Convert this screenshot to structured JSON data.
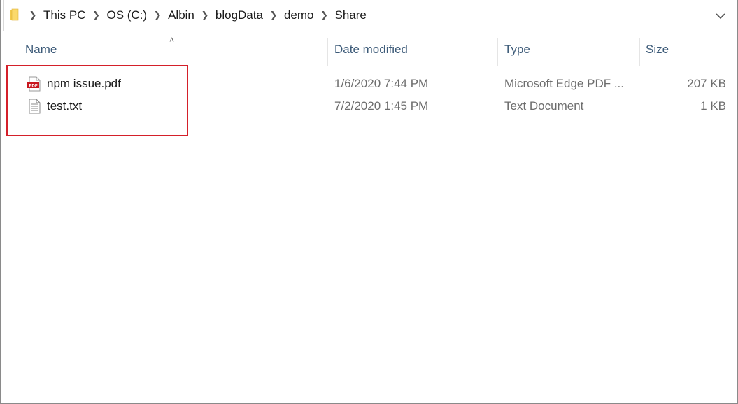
{
  "address_bar": {
    "breadcrumbs": [
      "This PC",
      "OS (C:)",
      "Albin",
      "blogData",
      "demo",
      "Share"
    ]
  },
  "columns": {
    "name": "Name",
    "date_modified": "Date modified",
    "type": "Type",
    "size": "Size"
  },
  "files": [
    {
      "name": "npm issue.pdf",
      "date_modified": "1/6/2020 7:44 PM",
      "type": "Microsoft Edge PDF ...",
      "size": "207 KB",
      "icon": "pdf-file-icon"
    },
    {
      "name": "test.txt",
      "date_modified": "7/2/2020 1:45 PM",
      "type": "Text Document",
      "size": "1 KB",
      "icon": "text-file-icon"
    }
  ],
  "colors": {
    "highlight": "#d4202a",
    "header_text": "#3c5a78",
    "pdf_red": "#c8171e"
  }
}
